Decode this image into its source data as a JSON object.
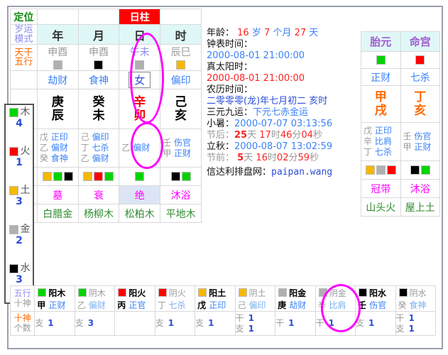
{
  "header": {
    "dingwei_label": "定位",
    "day_pillar_badge": "日柱",
    "suiyun_label_1": "岁运",
    "suiyun_label_2": "模式",
    "tiangan_label_1": "天干",
    "tiangan_label_2": "五行"
  },
  "pillars": {
    "names": [
      "年",
      "月",
      "日",
      "时"
    ],
    "kongwang": [
      "申酉",
      "申酉",
      "午未",
      "辰巳"
    ],
    "kongwang_colors": [
      "#b0b0b0",
      "#000000",
      "#b0b0b0",
      "#f5b800"
    ],
    "ten_gods": [
      "劫财",
      "食神",
      "女",
      "偏印"
    ],
    "stems": [
      "庚",
      "癸",
      "辛",
      "己"
    ],
    "branches": [
      "辰",
      "未",
      "卯",
      "亥"
    ],
    "hidden": [
      [
        {
          "stem": "戊",
          "god": "正印"
        },
        {
          "stem": "乙",
          "god": "偏财"
        },
        {
          "stem": "癸",
          "god": "食神"
        }
      ],
      [
        {
          "stem": "己",
          "god": "偏印"
        },
        {
          "stem": "丁",
          "god": "七杀"
        },
        {
          "stem": "乙",
          "god": "偏财"
        }
      ],
      [
        {
          "stem": "乙",
          "god": "偏财"
        }
      ],
      [
        {
          "stem": "壬",
          "god": "伤官"
        },
        {
          "stem": "甲",
          "god": "正财"
        }
      ]
    ],
    "chips": [
      [
        "#f5b800",
        "#00d400",
        "#000000"
      ],
      [
        "#f5b800",
        "#ff0000",
        "#00d400"
      ],
      [
        "#00d400"
      ],
      [
        "#000000",
        "#00d400"
      ]
    ],
    "changsheng": [
      "墓",
      "衰",
      "绝",
      "沐浴"
    ],
    "nayin": [
      "白腊金",
      "杨柳木",
      "松柏木",
      "平地木"
    ]
  },
  "elements": {
    "items": [
      {
        "color": "#00d400",
        "name": "木",
        "count": "4"
      },
      {
        "color": "#ff0000",
        "name": "火",
        "count": "1"
      },
      {
        "color": "#f5b800",
        "name": "土",
        "count": "3"
      },
      {
        "color": "#b0b0b0",
        "name": "金",
        "count": "2"
      },
      {
        "color": "#000000",
        "name": "水",
        "count": "3"
      }
    ]
  },
  "info": {
    "age_label": "年龄：",
    "age_years": "16",
    "age_years_unit": "岁",
    "age_months": "7",
    "age_months_unit": "个月",
    "age_days": "27",
    "age_days_unit": "天",
    "clock_label": "钟表时间：",
    "clock_value": "2000-08-01 21:00:00",
    "truesolar_label": "真太阳时：",
    "truesolar_value": "2000-08-01 21:00:00",
    "lunar_label": "农历时间：",
    "lunar_value": "二零零零(龙)年七月初二 亥时",
    "sanyuan_label": "三元九运：",
    "sanyuan_value": "下元七赤金运",
    "xiaoshu_label": "小暑：",
    "xiaoshu_value": "2000-07-07 03:13:56",
    "jiehou_label": "节后：",
    "jiehou_days": "25",
    "jiehou_days_unit": "天",
    "jiehou_h": "17",
    "jiehou_h_unit": "时",
    "jiehou_m": "46",
    "jiehou_m_unit": "分",
    "jiehou_s": "04",
    "jiehou_s_unit": "秒",
    "liqiu_label": "立秋：",
    "liqiu_value": "2000-08-07 13:02:59",
    "jieqian_label": "节前：",
    "jieqian_days": "5",
    "jieqian_days_unit": "天",
    "jieqian_h": "16",
    "jieqian_h_unit": "时",
    "jieqian_m": "02",
    "jieqian_m_unit": "分",
    "jieqian_s": "59",
    "jieqian_s_unit": "秒",
    "site_label": "信达利排盘网：",
    "site_value": "paipan.wang"
  },
  "rightpanel": {
    "titles": [
      "胎元",
      "命宫"
    ],
    "chips": [
      "#00d400",
      "#ff0000"
    ],
    "ten_gods": [
      "正财",
      "七杀"
    ],
    "stems": [
      "甲",
      "丁"
    ],
    "branches": [
      "戌",
      "亥"
    ],
    "hidden": [
      [
        {
          "stem": "戊",
          "god": "正印"
        },
        {
          "stem": "辛",
          "god": "比肩"
        },
        {
          "stem": "丁",
          "god": "七杀"
        }
      ],
      [
        {
          "stem": "壬",
          "god": "伤官"
        },
        {
          "stem": "甲",
          "god": "正财"
        }
      ]
    ],
    "chip_rows": [
      [
        "#f5b800",
        "#b0b0b0",
        "#ff0000"
      ],
      [
        "#000000",
        "#00d400"
      ]
    ],
    "changsheng": [
      "冠带",
      "沐浴"
    ],
    "nayin": [
      "山头火",
      "屋上土"
    ]
  },
  "bottom": {
    "label_row1_a": "五行",
    "label_row1_b": "十神",
    "label_row2_a": "十神",
    "label_row2_b": "个数",
    "columns": [
      {
        "color": "#00d400",
        "yinyang": "阳木",
        "stem": "甲",
        "god": "正财",
        "gan": "",
        "gan_n": "",
        "zhi": "支",
        "zhi_n": "1",
        "dim": false
      },
      {
        "color": "#00d400",
        "yinyang": "阴木",
        "stem": "乙",
        "god": "偏财",
        "gan": "",
        "gan_n": "",
        "zhi": "支",
        "zhi_n": "3",
        "dim": true
      },
      {
        "color": "#ff0000",
        "yinyang": "阳火",
        "stem": "丙",
        "god": "正官",
        "gan": "",
        "gan_n": "",
        "zhi": "",
        "zhi_n": "",
        "dim": false
      },
      {
        "color": "#ff0000",
        "yinyang": "阴火",
        "stem": "丁",
        "god": "七杀",
        "gan": "",
        "gan_n": "",
        "zhi": "支",
        "zhi_n": "1",
        "dim": true
      },
      {
        "color": "#f5b800",
        "yinyang": "阳土",
        "stem": "戊",
        "god": "正印",
        "gan": "",
        "gan_n": "",
        "zhi": "支",
        "zhi_n": "1",
        "dim": false
      },
      {
        "color": "#f5b800",
        "yinyang": "阴土",
        "stem": "己",
        "god": "偏印",
        "gan": "干",
        "gan_n": "1",
        "zhi": "支",
        "zhi_n": "1",
        "dim": true
      },
      {
        "color": "#b0b0b0",
        "yinyang": "阳金",
        "stem": "庚",
        "god": "劫财",
        "gan": "干",
        "gan_n": "1",
        "zhi": "",
        "zhi_n": "",
        "dim": false
      },
      {
        "color": "#b0b0b0",
        "yinyang": "阴金",
        "stem": "辛",
        "god": "比肩",
        "gan": "干",
        "gan_n": "1",
        "zhi": "",
        "zhi_n": "",
        "dim": true
      },
      {
        "color": "#000000",
        "yinyang": "阳水",
        "stem": "壬",
        "god": "伤官",
        "gan": "",
        "gan_n": "",
        "zhi": "支",
        "zhi_n": "1",
        "dim": false
      },
      {
        "color": "#000000",
        "yinyang": "阴水",
        "stem": "癸",
        "god": "食神",
        "gan": "干",
        "gan_n": "1",
        "zhi": "支",
        "zhi_n": "1",
        "dim": true
      }
    ]
  }
}
